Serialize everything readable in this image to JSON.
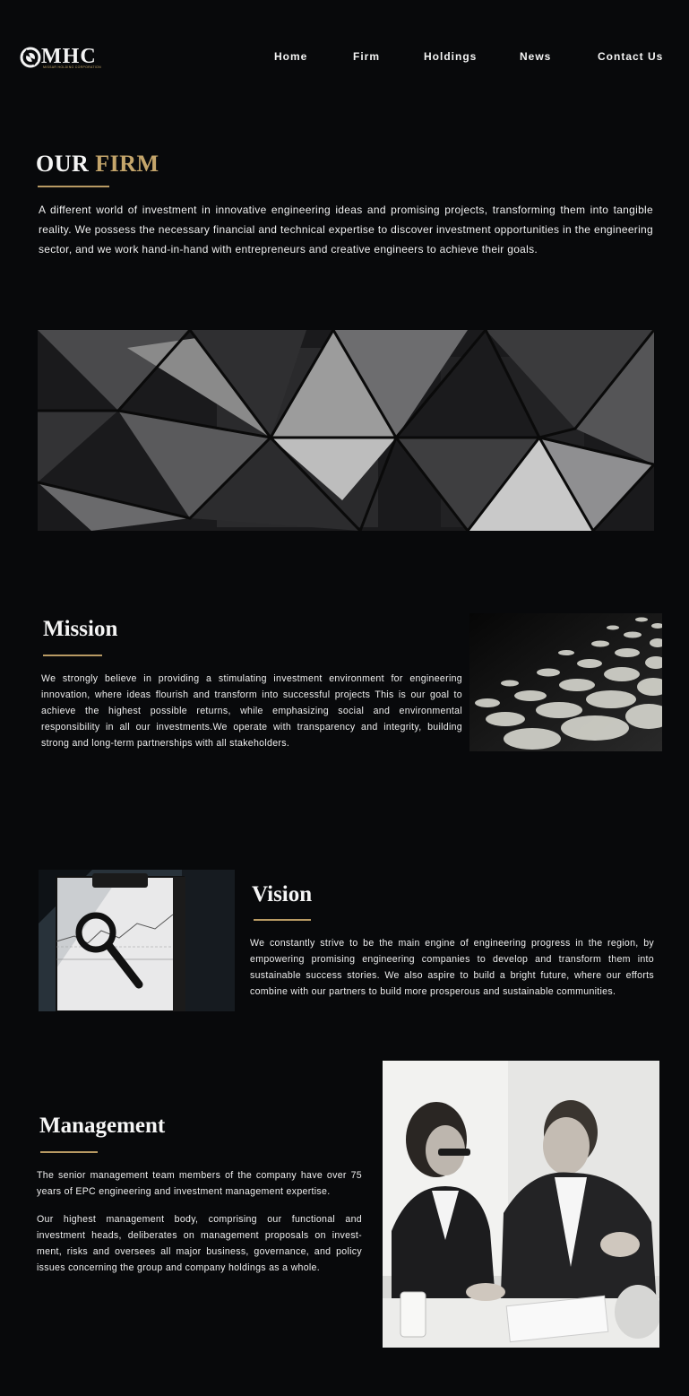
{
  "header": {
    "logo_text": "MHC",
    "logo_subtitle": "MISSAR HOLDING CORPORATION",
    "nav": [
      {
        "label": "Home"
      },
      {
        "label": "Firm"
      },
      {
        "label": "Holdings"
      },
      {
        "label": "News"
      },
      {
        "label": "Contact Us"
      }
    ]
  },
  "firm": {
    "title_part1": "OUR",
    "title_part2": "FIRM",
    "description": "A different world of investment in innovative engineering ideas and promising projects, transforming them into tangible reality. We possess the necessary financial and technical expertise to discover investment opportunities in the engineering sector, and we work hand-in-hand with entrepreneurs and creative engineers to achieve their goals."
  },
  "mission": {
    "title": "Mission",
    "text": "We strongly believe in providing a stimulating investment environment for engineering innovation, where ideas flourish and transform into successful projects This is our goal to achieve the highest possible returns, while emphasizing social and environmental responsibility in all our investments.We operate with transparency and integrity, building strong and long-term partnerships with all stakeholders."
  },
  "vision": {
    "title": "Vision",
    "text": "We constantly strive to be the main engine of engineering progress in the region, by empowering promising engineering companies to develop and transform them into sustainable success stories. We also aspire to build a bright future, where our efforts combine with our partners to build more prosperous and sustainable communities."
  },
  "management": {
    "title": "Management",
    "paragraph1": "The senior management team members of the company have over 75 years of EPC engineering and investment management expertise.",
    "paragraph2": "Our highest management body, comprising our functional and investment heads, deliberates on management proposals on invest-ment, risks and oversees all major business, governance, and policy issues concerning the group and company holdings as a whole."
  },
  "colors": {
    "background": "#08090b",
    "accent_gold": "#c4a56b",
    "text": "#f2f2f2"
  }
}
